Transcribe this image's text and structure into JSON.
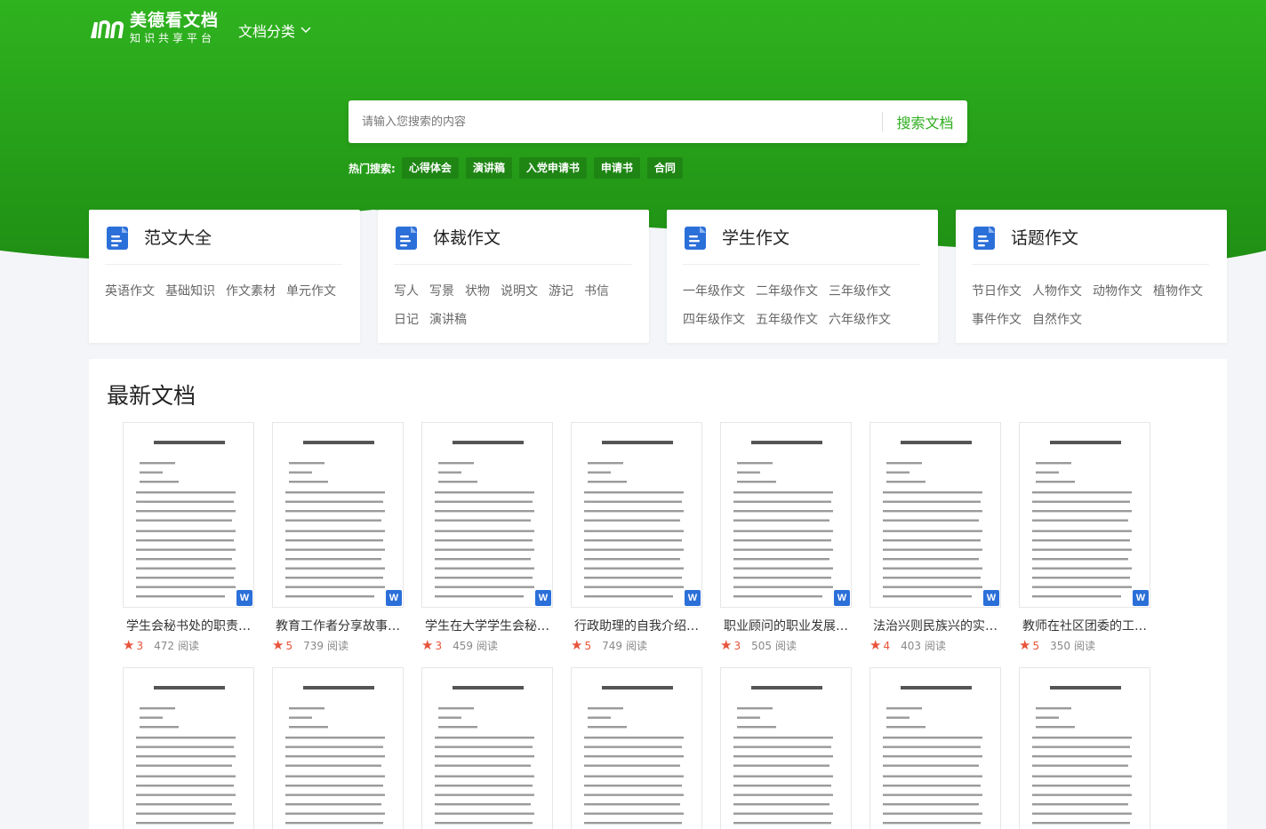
{
  "header": {
    "logo_title": "美德看文档",
    "logo_subtitle": "知识共享平台",
    "nav_category": "文档分类"
  },
  "colors": {
    "brand_green": "#2fae1f",
    "accent_blue": "#2b6fd9",
    "star_red": "#e8533a"
  },
  "search": {
    "placeholder": "请输入您搜索的内容",
    "button": "搜索文档"
  },
  "hot_search": {
    "label": "热门搜索:",
    "tags": [
      "心得体会",
      "演讲稿",
      "入党申请书",
      "申请书",
      "合同"
    ]
  },
  "categories": [
    {
      "title": "范文大全",
      "links": [
        "英语作文",
        "基础知识",
        "作文素材",
        "单元作文"
      ]
    },
    {
      "title": "体裁作文",
      "links": [
        "写人",
        "写景",
        "状物",
        "说明文",
        "游记",
        "书信",
        "日记",
        "演讲稿"
      ]
    },
    {
      "title": "学生作文",
      "links": [
        "一年级作文",
        "二年级作文",
        "三年级作文",
        "四年级作文",
        "五年级作文",
        "六年级作文"
      ]
    },
    {
      "title": "话题作文",
      "links": [
        "节日作文",
        "人物作文",
        "动物作文",
        "植物作文",
        "事件作文",
        "自然作文"
      ]
    }
  ],
  "latest": {
    "title": "最新文档",
    "read_suffix": "阅读",
    "docs": [
      {
        "title": "学生会秘书处的职责…",
        "rating": "3",
        "reads": "472"
      },
      {
        "title": "教育工作者分享故事…",
        "rating": "5",
        "reads": "739"
      },
      {
        "title": "学生在大学学生会秘…",
        "rating": "3",
        "reads": "459"
      },
      {
        "title": "行政助理的自我介绍…",
        "rating": "5",
        "reads": "749"
      },
      {
        "title": "职业顾问的职业发展…",
        "rating": "3",
        "reads": "505"
      },
      {
        "title": "法治兴则民族兴的实…",
        "rating": "4",
        "reads": "403"
      },
      {
        "title": "教师在社区团委的工…",
        "rating": "5",
        "reads": "350"
      }
    ]
  }
}
